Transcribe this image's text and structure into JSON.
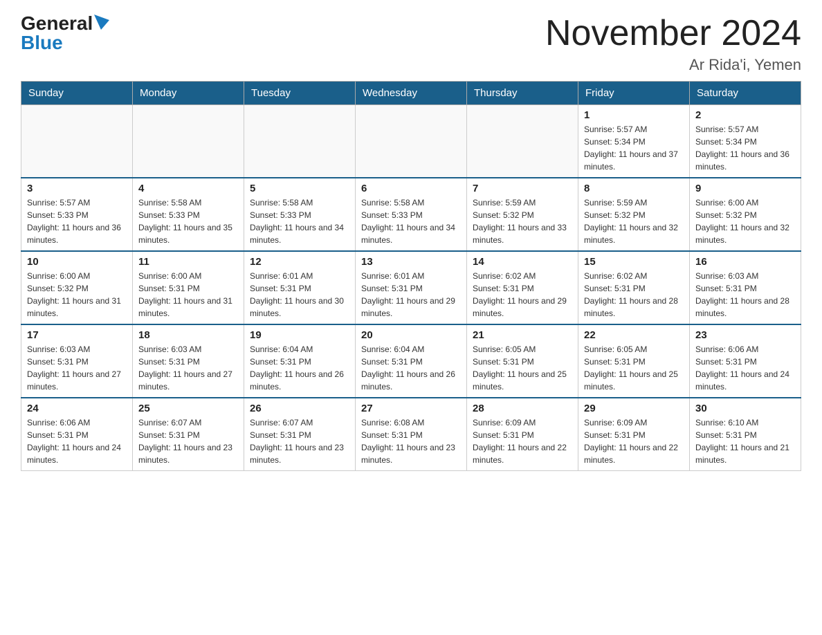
{
  "header": {
    "logo_general": "General",
    "logo_blue": "Blue",
    "month_title": "November 2024",
    "subtitle": "Ar Rida'i, Yemen"
  },
  "weekdays": [
    "Sunday",
    "Monday",
    "Tuesday",
    "Wednesday",
    "Thursday",
    "Friday",
    "Saturday"
  ],
  "weeks": [
    [
      {
        "num": "",
        "info": ""
      },
      {
        "num": "",
        "info": ""
      },
      {
        "num": "",
        "info": ""
      },
      {
        "num": "",
        "info": ""
      },
      {
        "num": "",
        "info": ""
      },
      {
        "num": "1",
        "info": "Sunrise: 5:57 AM\nSunset: 5:34 PM\nDaylight: 11 hours and 37 minutes."
      },
      {
        "num": "2",
        "info": "Sunrise: 5:57 AM\nSunset: 5:34 PM\nDaylight: 11 hours and 36 minutes."
      }
    ],
    [
      {
        "num": "3",
        "info": "Sunrise: 5:57 AM\nSunset: 5:33 PM\nDaylight: 11 hours and 36 minutes."
      },
      {
        "num": "4",
        "info": "Sunrise: 5:58 AM\nSunset: 5:33 PM\nDaylight: 11 hours and 35 minutes."
      },
      {
        "num": "5",
        "info": "Sunrise: 5:58 AM\nSunset: 5:33 PM\nDaylight: 11 hours and 34 minutes."
      },
      {
        "num": "6",
        "info": "Sunrise: 5:58 AM\nSunset: 5:33 PM\nDaylight: 11 hours and 34 minutes."
      },
      {
        "num": "7",
        "info": "Sunrise: 5:59 AM\nSunset: 5:32 PM\nDaylight: 11 hours and 33 minutes."
      },
      {
        "num": "8",
        "info": "Sunrise: 5:59 AM\nSunset: 5:32 PM\nDaylight: 11 hours and 32 minutes."
      },
      {
        "num": "9",
        "info": "Sunrise: 6:00 AM\nSunset: 5:32 PM\nDaylight: 11 hours and 32 minutes."
      }
    ],
    [
      {
        "num": "10",
        "info": "Sunrise: 6:00 AM\nSunset: 5:32 PM\nDaylight: 11 hours and 31 minutes."
      },
      {
        "num": "11",
        "info": "Sunrise: 6:00 AM\nSunset: 5:31 PM\nDaylight: 11 hours and 31 minutes."
      },
      {
        "num": "12",
        "info": "Sunrise: 6:01 AM\nSunset: 5:31 PM\nDaylight: 11 hours and 30 minutes."
      },
      {
        "num": "13",
        "info": "Sunrise: 6:01 AM\nSunset: 5:31 PM\nDaylight: 11 hours and 29 minutes."
      },
      {
        "num": "14",
        "info": "Sunrise: 6:02 AM\nSunset: 5:31 PM\nDaylight: 11 hours and 29 minutes."
      },
      {
        "num": "15",
        "info": "Sunrise: 6:02 AM\nSunset: 5:31 PM\nDaylight: 11 hours and 28 minutes."
      },
      {
        "num": "16",
        "info": "Sunrise: 6:03 AM\nSunset: 5:31 PM\nDaylight: 11 hours and 28 minutes."
      }
    ],
    [
      {
        "num": "17",
        "info": "Sunrise: 6:03 AM\nSunset: 5:31 PM\nDaylight: 11 hours and 27 minutes."
      },
      {
        "num": "18",
        "info": "Sunrise: 6:03 AM\nSunset: 5:31 PM\nDaylight: 11 hours and 27 minutes."
      },
      {
        "num": "19",
        "info": "Sunrise: 6:04 AM\nSunset: 5:31 PM\nDaylight: 11 hours and 26 minutes."
      },
      {
        "num": "20",
        "info": "Sunrise: 6:04 AM\nSunset: 5:31 PM\nDaylight: 11 hours and 26 minutes."
      },
      {
        "num": "21",
        "info": "Sunrise: 6:05 AM\nSunset: 5:31 PM\nDaylight: 11 hours and 25 minutes."
      },
      {
        "num": "22",
        "info": "Sunrise: 6:05 AM\nSunset: 5:31 PM\nDaylight: 11 hours and 25 minutes."
      },
      {
        "num": "23",
        "info": "Sunrise: 6:06 AM\nSunset: 5:31 PM\nDaylight: 11 hours and 24 minutes."
      }
    ],
    [
      {
        "num": "24",
        "info": "Sunrise: 6:06 AM\nSunset: 5:31 PM\nDaylight: 11 hours and 24 minutes."
      },
      {
        "num": "25",
        "info": "Sunrise: 6:07 AM\nSunset: 5:31 PM\nDaylight: 11 hours and 23 minutes."
      },
      {
        "num": "26",
        "info": "Sunrise: 6:07 AM\nSunset: 5:31 PM\nDaylight: 11 hours and 23 minutes."
      },
      {
        "num": "27",
        "info": "Sunrise: 6:08 AM\nSunset: 5:31 PM\nDaylight: 11 hours and 23 minutes."
      },
      {
        "num": "28",
        "info": "Sunrise: 6:09 AM\nSunset: 5:31 PM\nDaylight: 11 hours and 22 minutes."
      },
      {
        "num": "29",
        "info": "Sunrise: 6:09 AM\nSunset: 5:31 PM\nDaylight: 11 hours and 22 minutes."
      },
      {
        "num": "30",
        "info": "Sunrise: 6:10 AM\nSunset: 5:31 PM\nDaylight: 11 hours and 21 minutes."
      }
    ]
  ]
}
